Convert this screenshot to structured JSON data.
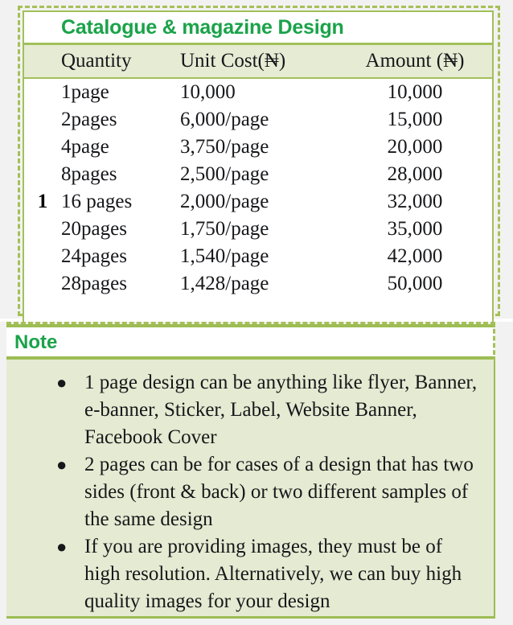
{
  "table": {
    "title": "Catalogue & magazine Design",
    "row_number": "1",
    "columns": [
      "Quantity",
      "Unit Cost(₦)",
      "Amount (₦)"
    ],
    "rows": [
      {
        "quantity": "1page",
        "unit_cost": "10,000",
        "amount": "10,000"
      },
      {
        "quantity": "2pages",
        "unit_cost": "6,000/page",
        "amount": "15,000"
      },
      {
        "quantity": "4page",
        "unit_cost": "3,750/page",
        "amount": "20,000"
      },
      {
        "quantity": "8pages",
        "unit_cost": "2,500/page",
        "amount": "28,000"
      },
      {
        "quantity": "16 pages",
        "unit_cost": "2,000/page",
        "amount": "32,000"
      },
      {
        "quantity": "20pages",
        "unit_cost": "1,750/page",
        "amount": "35,000"
      },
      {
        "quantity": "24pages",
        "unit_cost": "1,540/page",
        "amount": "42,000"
      },
      {
        "quantity": "28pages",
        "unit_cost": "1,428/page",
        "amount": "50,000"
      }
    ]
  },
  "note": {
    "title": "Note",
    "bullet_glyph": "●",
    "items": [
      "1 page design can be anything like flyer, Banner, e-banner, Sticker, Label, Website Banner, Facebook Cover",
      "2 pages can be for cases of a design that has two sides (front & back) or two different samples of the same design",
      "If you are providing images, they must be of high resolution. Alternatively, we can buy high quality images for your design"
    ]
  },
  "colors": {
    "title_green": "#1aa349",
    "border_green": "#a2c05a",
    "header_fill": "#e6ebd4",
    "note_fill": "#e4ebd2",
    "text": "#16171a"
  }
}
